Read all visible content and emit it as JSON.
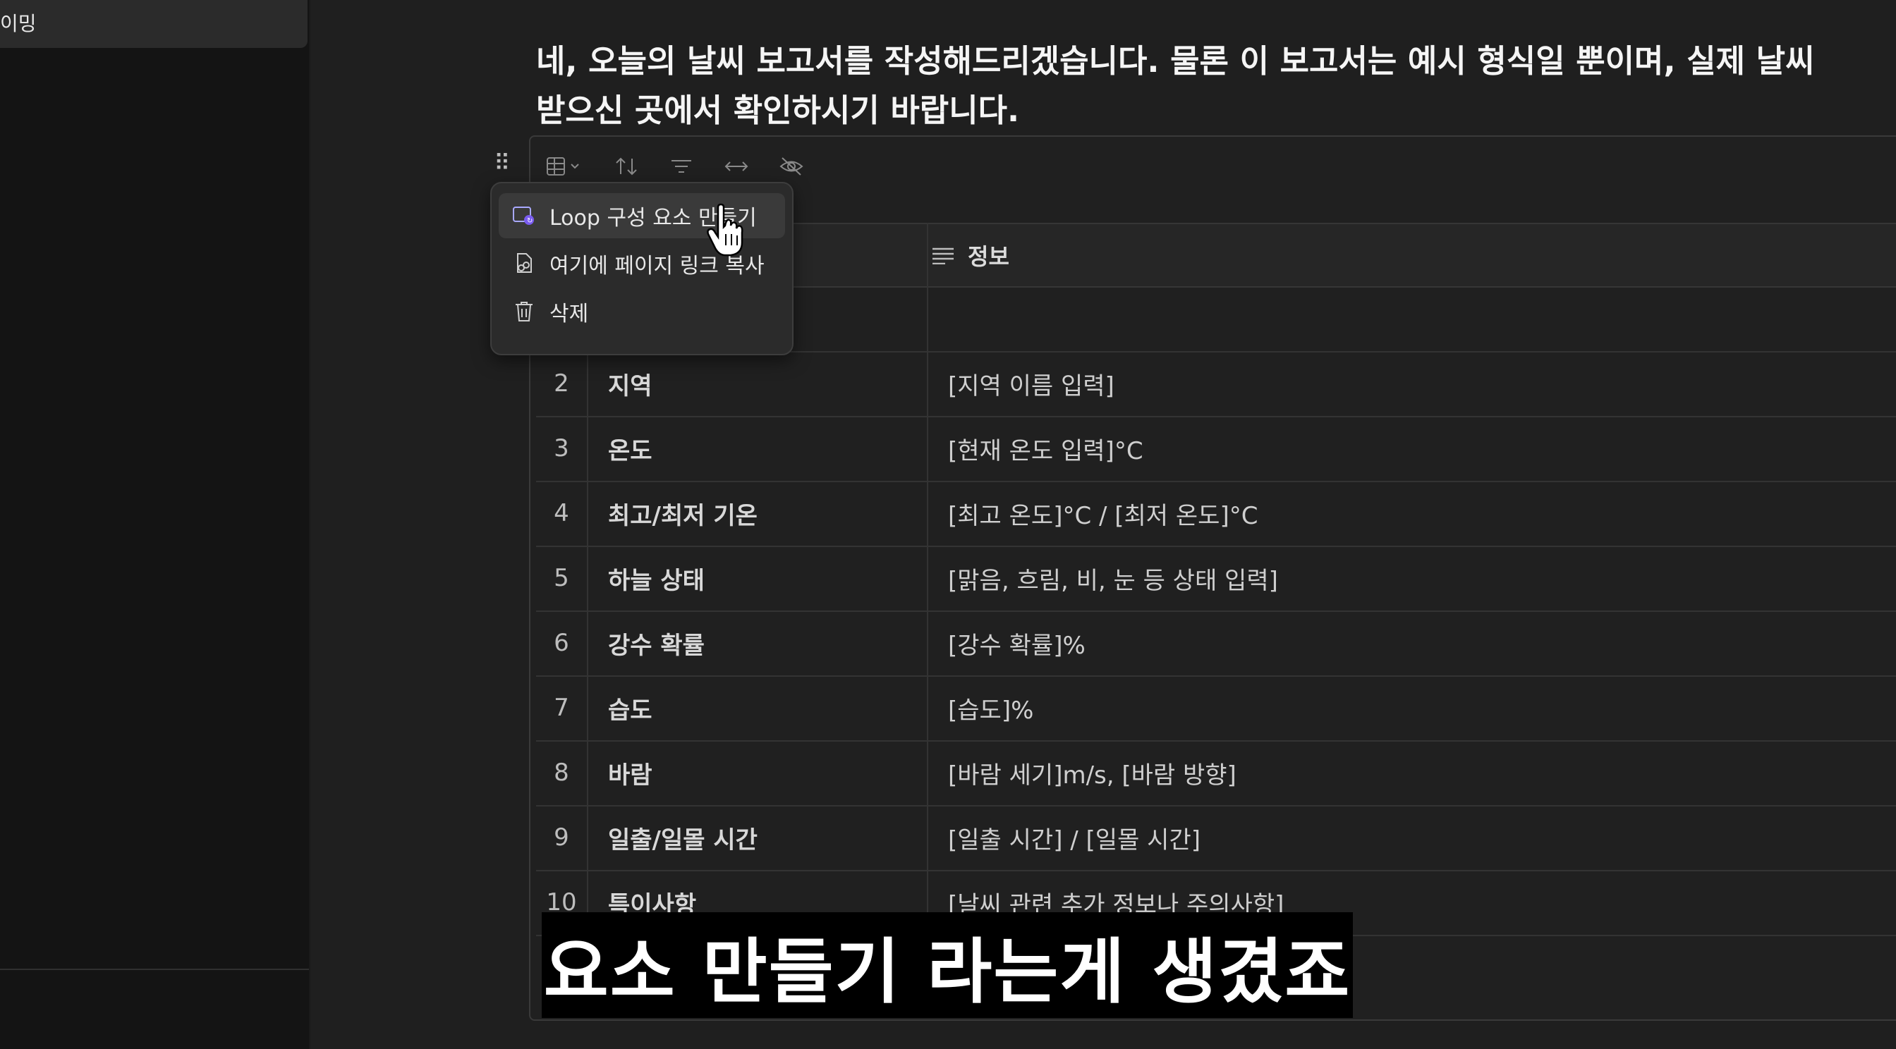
{
  "sidebar": {
    "top_item_label": "이밍"
  },
  "message": {
    "line1": "네, 오늘의 날씨 보고서를 작성해드리겠습니다. 물론 이 보고서는 예시 형식일 뿐이며, 실제 날씨",
    "line2": "받으신 곳에서 확인하시기 바랍니다."
  },
  "toolbar": {
    "icons": [
      "table-view-icon",
      "chevron-down-icon",
      "sort-icon",
      "filter-icon",
      "column-width-icon",
      "hide-icon"
    ]
  },
  "context_menu": {
    "items": [
      {
        "label": "Loop 구성 요소 만들기",
        "icon": "loop-component-icon"
      },
      {
        "label": "여기에 페이지 링크 복사",
        "icon": "link-copy-icon"
      },
      {
        "label": "삭제",
        "icon": "trash-icon"
      }
    ]
  },
  "table": {
    "header": {
      "info": "정보"
    },
    "rows": [
      {
        "num": "2",
        "key": "지역",
        "value": "[지역 이름 입력]"
      },
      {
        "num": "3",
        "key": "온도",
        "value": "[현재 온도 입력]°C"
      },
      {
        "num": "4",
        "key": "최고/최저 기온",
        "value": "[최고 온도]°C / [최저 온도]°C"
      },
      {
        "num": "5",
        "key": "하늘 상태",
        "value": "[맑음, 흐림, 비, 눈 등 상태 입력]"
      },
      {
        "num": "6",
        "key": "강수 확률",
        "value": "[강수 확률]%"
      },
      {
        "num": "7",
        "key": "습도",
        "value": "[습도]%"
      },
      {
        "num": "8",
        "key": "바람",
        "value": "[바람 세기]m/s, [바람 방향]"
      },
      {
        "num": "9",
        "key": "일출/일몰 시간",
        "value": "[일출 시간] / [일몰 시간]"
      },
      {
        "num": "10",
        "key": "특이사항",
        "value": "[날씨 관련 추가 정보나 주의사항]"
      }
    ]
  },
  "caption": {
    "text": "요소 만들기 라는게 생겼죠"
  }
}
